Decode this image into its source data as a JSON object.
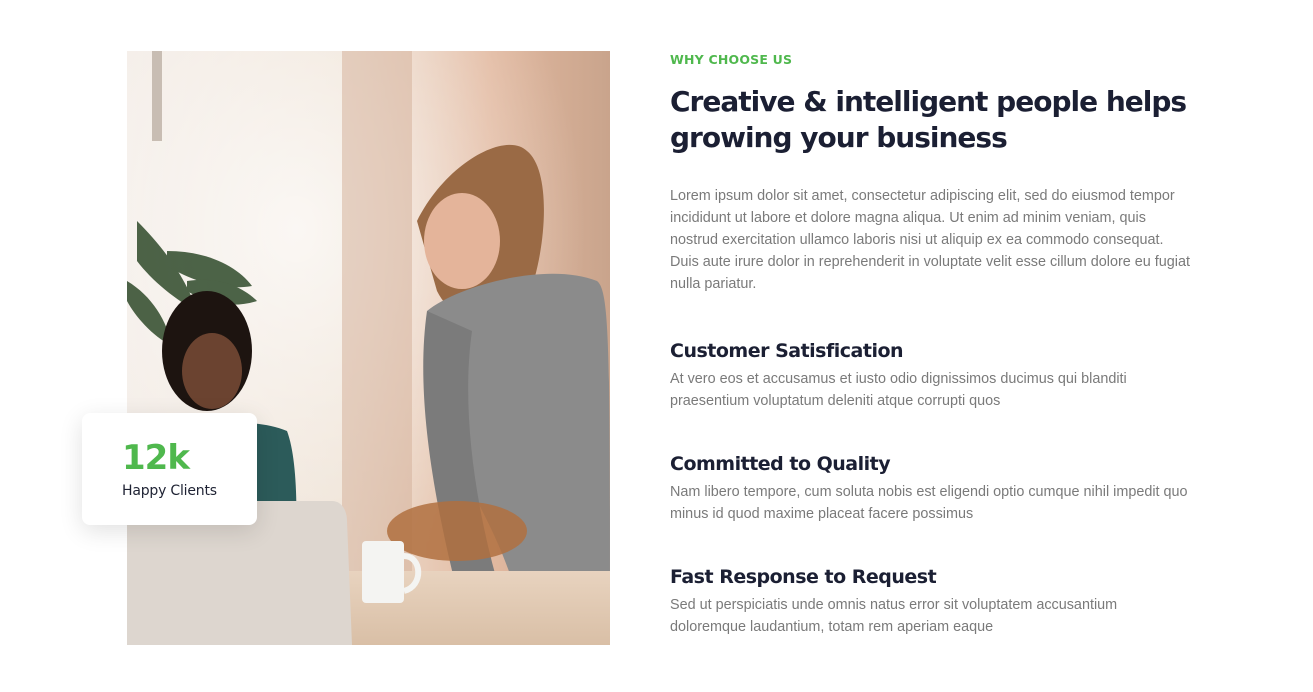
{
  "stat": {
    "value": "12k",
    "label": "Happy Clients"
  },
  "section": {
    "eyebrow": "WHY CHOOSE US",
    "headline": "Creative & intelligent people helps growing your business",
    "intro": "Lorem ipsum dolor sit amet, consectetur adipiscing elit, sed do eiusmod tempor incididunt ut labore et dolore magna aliqua. Ut enim ad minim veniam, quis nostrud exercitation ullamco laboris nisi ut aliquip ex ea commodo consequat. Duis aute irure dolor in reprehenderit in voluptate velit esse cillum dolore eu fugiat nulla pariatur."
  },
  "features": [
    {
      "title": "Customer Satisfication",
      "text": "At vero eos et accusamus et iusto odio dignissimos ducimus qui blanditi praesentium voluptatum deleniti atque corrupti quos"
    },
    {
      "title": "Committed to Quality",
      "text": "Nam libero tempore, cum soluta nobis est eligendi optio cumque nihil impedit quo minus id quod maxime placeat facere possimus"
    },
    {
      "title": "Fast Response to Request",
      "text": "Sed ut perspiciatis unde omnis natus error sit voluptatem accusantium doloremque laudantium, totam rem aperiam eaque"
    }
  ],
  "colors": {
    "accent": "#4fb84d",
    "heading": "#1b1f33",
    "body_text": "#7a7a7a"
  }
}
